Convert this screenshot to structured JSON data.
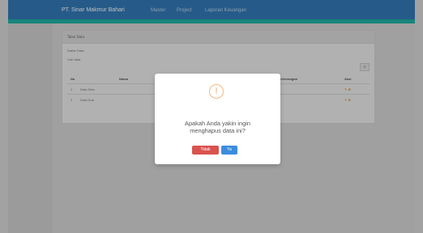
{
  "navbar": {
    "brand": "PT. Sinar Makmur Bahari",
    "links": [
      "Master",
      "Project",
      "Laporan Keuangan"
    ]
  },
  "panel": {
    "heading": "Tabel Data",
    "subtitle": "Daftar Data",
    "filter": "Cari data",
    "add_label": "+",
    "columns": [
      "No",
      "Nama",
      "Keterangan",
      "Aksi"
    ],
    "rows": [
      {
        "no": "1",
        "name": "Data Satu",
        "action": "✎ ✖"
      },
      {
        "no": "2",
        "name": "Data Dua",
        "action": "✎ ✖"
      }
    ]
  },
  "modal": {
    "icon": "!",
    "message_line1": "Apakah Anda yakin ingin",
    "message_line2": "menghapus data ini?",
    "cancel_label": "Tidak",
    "ok_label": "Ya"
  },
  "colors": {
    "navbar": "#337ab7",
    "navbar_accent": "#1fb3a4",
    "warning": "#f0a35c",
    "cancel": "#d9534f",
    "ok": "#3c8dde"
  }
}
